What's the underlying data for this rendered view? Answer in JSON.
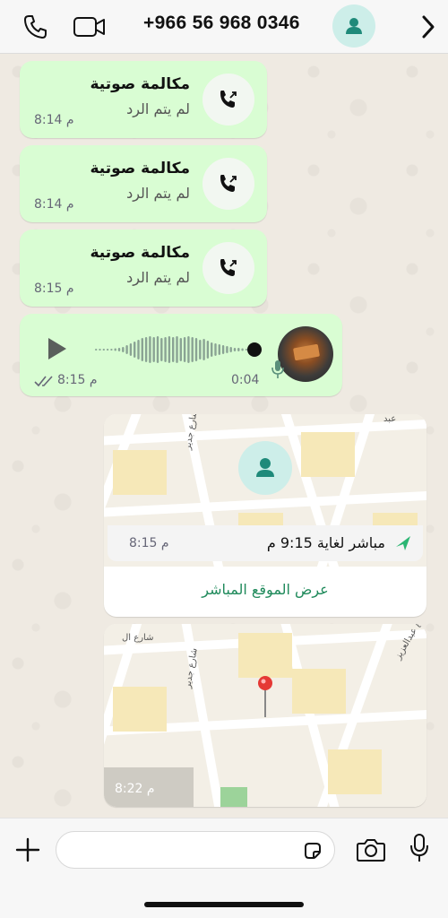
{
  "header": {
    "phone_number": "+966 56 968 0346",
    "icons": [
      "phone-icon",
      "video-icon",
      "chevron-right-icon"
    ]
  },
  "calls": [
    {
      "title": "مكالمة صوتية",
      "status": "لم يتم الرد",
      "time": "8:14 م"
    },
    {
      "title": "مكالمة صوتية",
      "status": "لم يتم الرد",
      "time": "8:14 م"
    },
    {
      "title": "مكالمة صوتية",
      "status": "لم يتم الرد",
      "time": "8:15 م"
    }
  ],
  "voice_message": {
    "duration": "0:04",
    "time": "8:15 م",
    "progress": 0
  },
  "live_location": {
    "status": "مباشر لغاية 9:15 م",
    "time": "8:15 م",
    "action": "عرض الموقع المباشر",
    "street_labels": [
      "شارع جدير",
      "عبد"
    ]
  },
  "static_location": {
    "time": "8:22 م",
    "street_labels": [
      "شارع عبدالعزيز",
      "شارع جدير",
      "شارع ال"
    ]
  },
  "input": {
    "placeholder": ""
  },
  "colors": {
    "bubble_green": "#d9fdd3",
    "accent": "#1f8a5b",
    "avatar_bg": "#cdeee9"
  }
}
